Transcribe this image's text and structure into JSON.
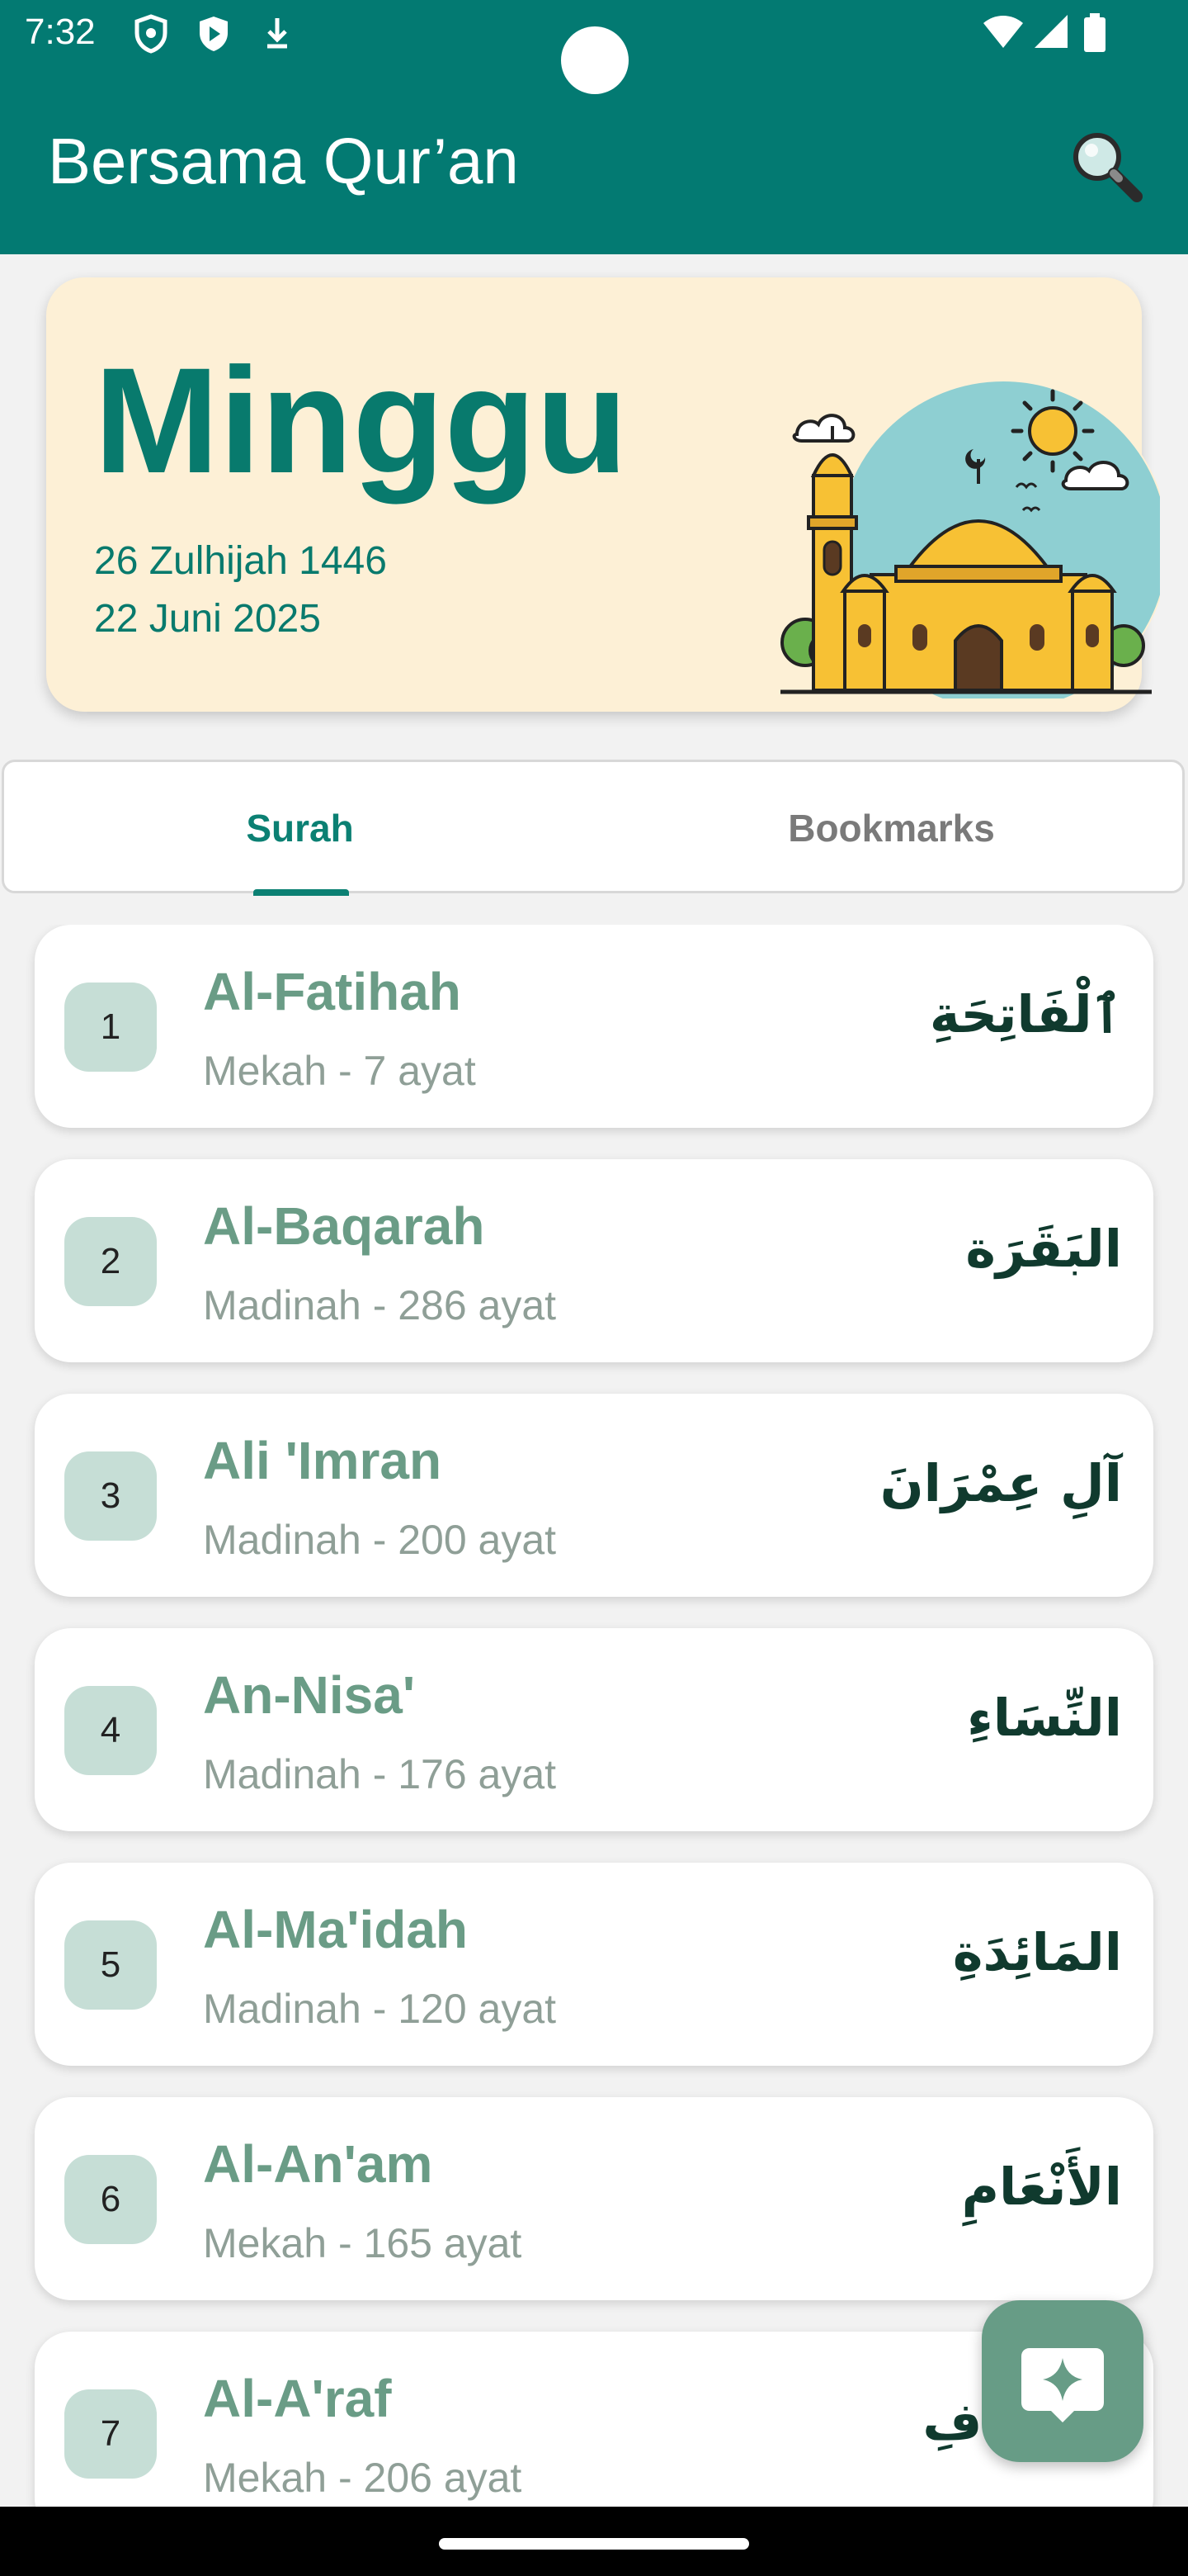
{
  "status_bar": {
    "time": "7:32"
  },
  "app_bar": {
    "title": "Bersama Qur’an"
  },
  "day_card": {
    "day": "Minggu",
    "hijri_date": "26 Zulhijah 1446",
    "gregorian_date": "22 Juni 2025"
  },
  "tabs": [
    {
      "label": "Surah",
      "selected": true
    },
    {
      "label": "Bookmarks",
      "selected": false
    }
  ],
  "surahs": [
    {
      "number": "1",
      "name": "Al-Fatihah",
      "meta": "Mekah - 7 ayat",
      "arabic": "ٱلْفَاتِحَةِ"
    },
    {
      "number": "2",
      "name": "Al-Baqarah",
      "meta": "Madinah - 286 ayat",
      "arabic": "البَقَرَة"
    },
    {
      "number": "3",
      "name": "Ali 'Imran",
      "meta": "Madinah - 200 ayat",
      "arabic": "آلِ عِمْرَانَ"
    },
    {
      "number": "4",
      "name": "An-Nisa'",
      "meta": "Madinah - 176 ayat",
      "arabic": "النِّسَاءِ"
    },
    {
      "number": "5",
      "name": "Al-Ma'idah",
      "meta": "Madinah - 120 ayat",
      "arabic": "المَائِدَةِ"
    },
    {
      "number": "6",
      "name": "Al-An'am",
      "meta": "Mekah - 165 ayat",
      "arabic": "الأَنْعَامِ"
    },
    {
      "number": "7",
      "name": "Al-A'raf",
      "meta": "Mekah - 206 ayat",
      "arabic": "الأَعْرَافِ"
    }
  ],
  "colors": {
    "app_bar": "#037a72",
    "accent": "#0b8073",
    "card_bg": "#fdf0d6",
    "fab": "#679c86"
  },
  "icons": {
    "search": "search-icon",
    "fab": "chat-sparkle-icon"
  }
}
